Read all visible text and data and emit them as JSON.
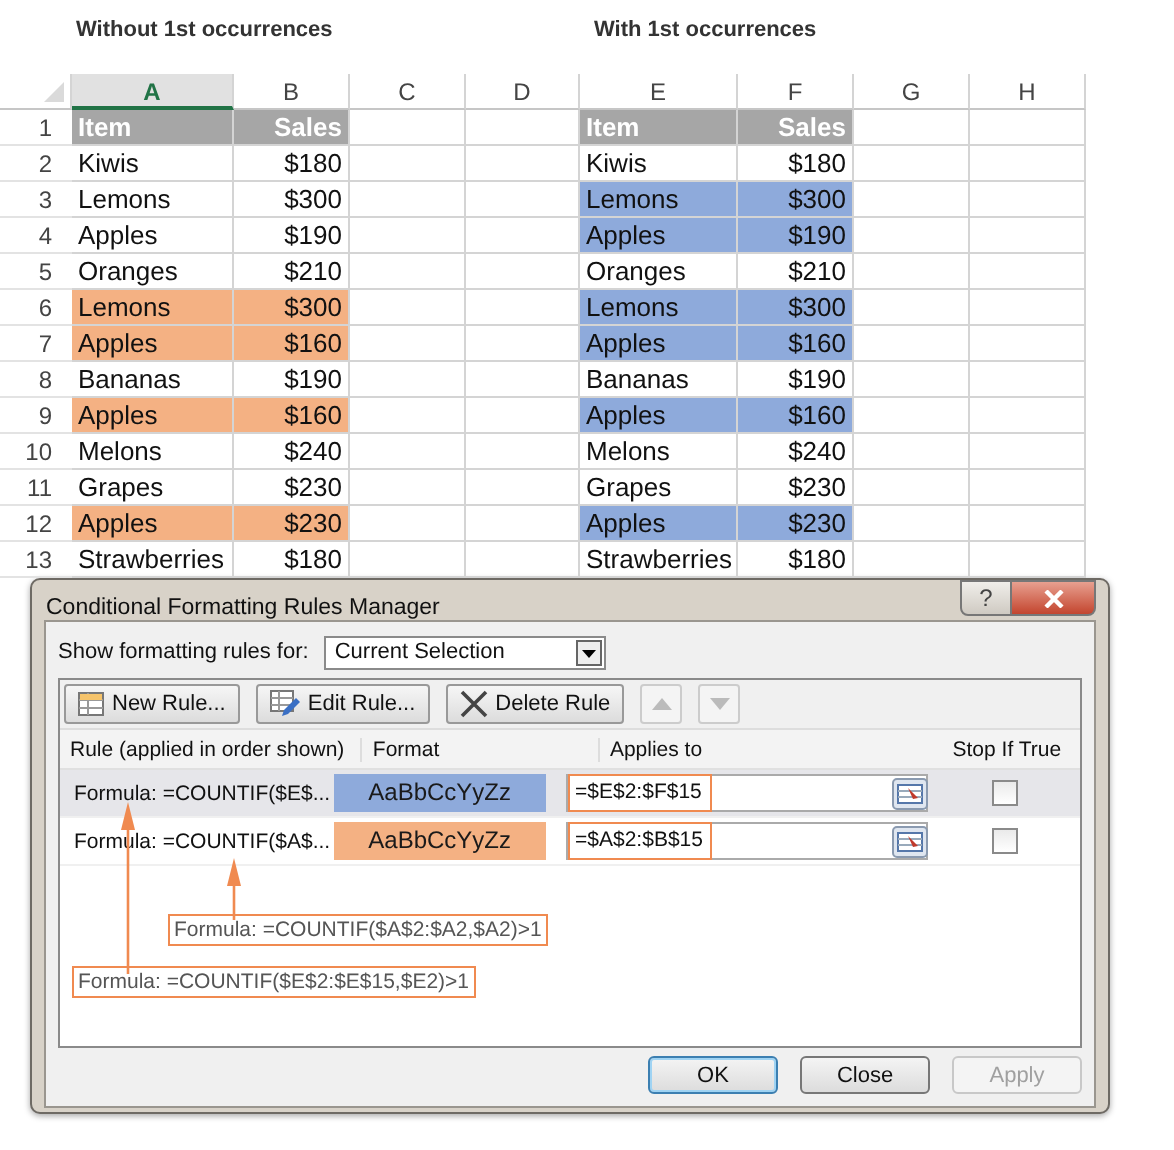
{
  "captions": [
    "Without 1st occurrences",
    "With 1st occurrences"
  ],
  "sheet": {
    "columns": [
      {
        "label": "A",
        "selected": true
      },
      {
        "label": "B",
        "selected": false
      },
      {
        "label": "C",
        "selected": false
      },
      {
        "label": "D",
        "selected": false
      },
      {
        "label": "E",
        "selected": false
      },
      {
        "label": "F",
        "selected": false
      },
      {
        "label": "G",
        "selected": false
      },
      {
        "label": "H",
        "selected": false
      }
    ],
    "rows": [
      {
        "number": "1",
        "kind": "header",
        "left": {
          "item": "Item",
          "sales": "Sales"
        },
        "right": {
          "item": "Item",
          "sales": "Sales"
        }
      },
      {
        "number": "2",
        "kind": "data",
        "left": {
          "item": "Kiwis",
          "sales": "$180"
        },
        "right": {
          "item": "Kiwis",
          "sales": "$180"
        }
      },
      {
        "number": "3",
        "kind": "data",
        "left": {
          "item": "Lemons",
          "sales": "$300"
        },
        "right": {
          "item": "Lemons",
          "sales": "$300",
          "color": "#8eaadb"
        }
      },
      {
        "number": "4",
        "kind": "data",
        "left": {
          "item": "Apples",
          "sales": "$190"
        },
        "right": {
          "item": "Apples",
          "sales": "$190",
          "color": "#8eaadb"
        }
      },
      {
        "number": "5",
        "kind": "data",
        "left": {
          "item": "Oranges",
          "sales": "$210"
        },
        "right": {
          "item": "Oranges",
          "sales": "$210"
        }
      },
      {
        "number": "6",
        "kind": "data",
        "left": {
          "item": "Lemons",
          "sales": "$300",
          "color": "#f4b183"
        },
        "right": {
          "item": "Lemons",
          "sales": "$300",
          "color": "#8eaadb"
        }
      },
      {
        "number": "7",
        "kind": "data",
        "left": {
          "item": "Apples",
          "sales": "$160",
          "color": "#f4b183"
        },
        "right": {
          "item": "Apples",
          "sales": "$160",
          "color": "#8eaadb"
        }
      },
      {
        "number": "8",
        "kind": "data",
        "left": {
          "item": "Bananas",
          "sales": "$190"
        },
        "right": {
          "item": "Bananas",
          "sales": "$190"
        }
      },
      {
        "number": "9",
        "kind": "data",
        "left": {
          "item": "Apples",
          "sales": "$160",
          "color": "#f4b183"
        },
        "right": {
          "item": "Apples",
          "sales": "$160",
          "color": "#8eaadb"
        }
      },
      {
        "number": "10",
        "kind": "data",
        "left": {
          "item": "Melons",
          "sales": "$240"
        },
        "right": {
          "item": "Melons",
          "sales": "$240"
        }
      },
      {
        "number": "11",
        "kind": "data",
        "left": {
          "item": "Grapes",
          "sales": "$230"
        },
        "right": {
          "item": "Grapes",
          "sales": "$230"
        }
      },
      {
        "number": "12",
        "kind": "data",
        "left": {
          "item": "Apples",
          "sales": "$230",
          "color": "#f4b183"
        },
        "right": {
          "item": "Apples",
          "sales": "$230",
          "color": "#8eaadb"
        }
      },
      {
        "number": "13",
        "kind": "data",
        "left": {
          "item": "Strawberries",
          "sales": "$180"
        },
        "right": {
          "item": "Strawberries",
          "sales": "$180"
        }
      }
    ]
  },
  "dialog": {
    "title": "Conditional Formatting Rules Manager",
    "help": "?",
    "show_label": "Show formatting rules for:",
    "show_value": "Current Selection",
    "toolbar": [
      {
        "label": "New Rule...",
        "kind": "new"
      },
      {
        "label": "Edit Rule...",
        "kind": "edit"
      },
      {
        "label": "Delete Rule",
        "kind": "delete"
      },
      {
        "kind": "up",
        "disabled": true
      },
      {
        "kind": "down",
        "disabled": true
      }
    ],
    "columns": [
      "Rule (applied in order shown)",
      "Format",
      "Applies to",
      "Stop If True"
    ],
    "rules": [
      {
        "rule": "Formula: =COUNTIF($E$...",
        "preview": "AaBbCcYyZz",
        "color": "#8eaadb",
        "applies_to": "=$E$2:$F$15",
        "stop_if_true": false,
        "selected": true
      },
      {
        "rule": "Formula: =COUNTIF($A$...",
        "preview": "AaBbCcYyZz",
        "color": "#f4b183",
        "applies_to": "=$A$2:$B$15",
        "stop_if_true": false,
        "selected": false
      }
    ],
    "callouts": [
      "Formula: =COUNTIF($A$2:$A2,$A2)>1",
      "Formula: =COUNTIF($E$2:$E$15,$E2)>1"
    ],
    "buttons": [
      {
        "label": "OK",
        "disabled": false,
        "default": true
      },
      {
        "label": "Close",
        "disabled": false,
        "default": false
      },
      {
        "label": "Apply",
        "disabled": true,
        "default": false
      }
    ]
  }
}
